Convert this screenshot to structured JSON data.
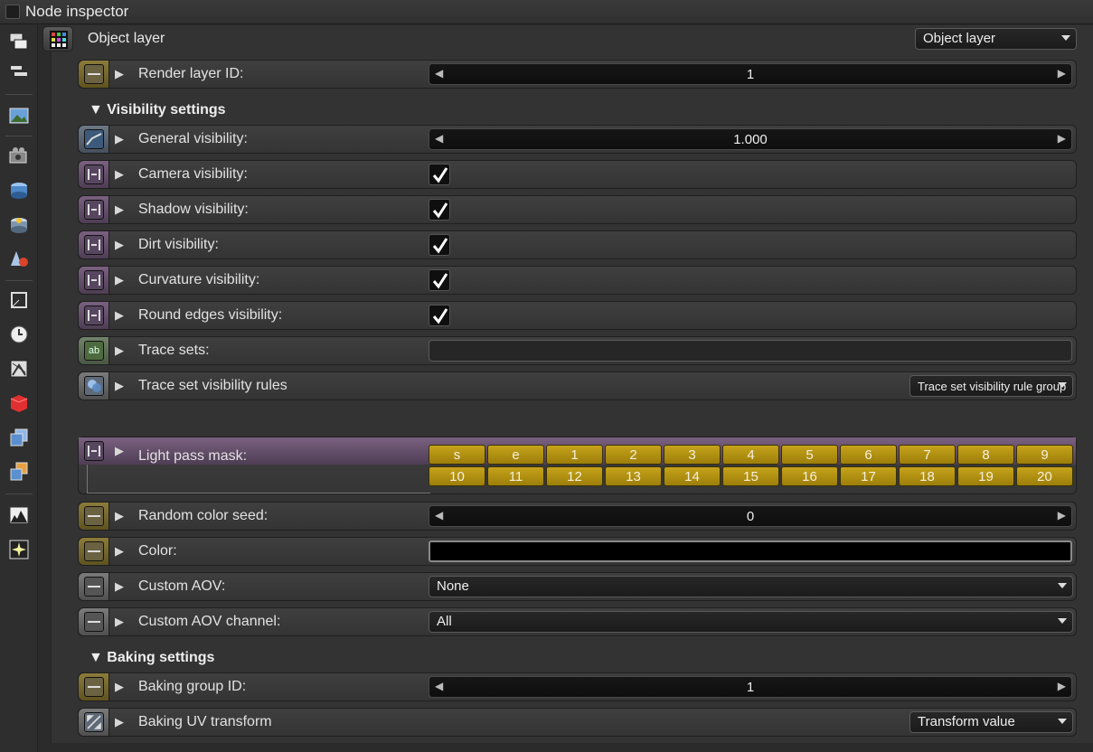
{
  "window": {
    "title": "Node inspector"
  },
  "header": {
    "label": "Object layer",
    "dropdown_value": "Object layer"
  },
  "rows": {
    "render_layer_id": {
      "label": "Render layer ID:",
      "value": "1"
    },
    "general_visibility": {
      "label": "General visibility:",
      "value": "1.000"
    },
    "camera_visibility": {
      "label": "Camera visibility:",
      "checked": true
    },
    "shadow_visibility": {
      "label": "Shadow visibility:",
      "checked": true
    },
    "dirt_visibility": {
      "label": "Dirt visibility:",
      "checked": true
    },
    "curvature_visibility": {
      "label": "Curvature visibility:",
      "checked": true
    },
    "round_edges_visibility": {
      "label": "Round edges visibility:",
      "checked": true
    },
    "trace_sets": {
      "label": "Trace sets:",
      "value": ""
    },
    "trace_set_visibility_rules": {
      "label": "Trace set visibility rules",
      "dropdown_value": "Trace set visibility rule group"
    },
    "light_pass_mask": {
      "label": "Light pass mask:",
      "buttons": [
        "s",
        "e",
        "1",
        "2",
        "3",
        "4",
        "5",
        "6",
        "7",
        "8",
        "9",
        "10",
        "11",
        "12",
        "13",
        "14",
        "15",
        "16",
        "17",
        "18",
        "19",
        "20"
      ]
    },
    "random_color_seed": {
      "label": "Random color seed:",
      "value": "0"
    },
    "color": {
      "label": "Color:",
      "value": "#000000"
    },
    "custom_aov": {
      "label": "Custom AOV:",
      "dropdown_value": "None"
    },
    "custom_aov_channel": {
      "label": "Custom AOV channel:",
      "dropdown_value": "All"
    },
    "baking_group_id": {
      "label": "Baking group ID:",
      "value": "1"
    },
    "baking_uv_transform": {
      "label": "Baking UV transform",
      "dropdown_value": "Transform value"
    }
  },
  "sections": {
    "visibility": "▼ Visibility settings",
    "baking": "▼ Baking settings"
  },
  "glyphs": {
    "expand": "▶",
    "left": "◀",
    "right": "▶"
  },
  "colors": {
    "accent_gold": "#b8960f",
    "panel_bg": "#333333",
    "row_bg": "#3a3a3a"
  }
}
